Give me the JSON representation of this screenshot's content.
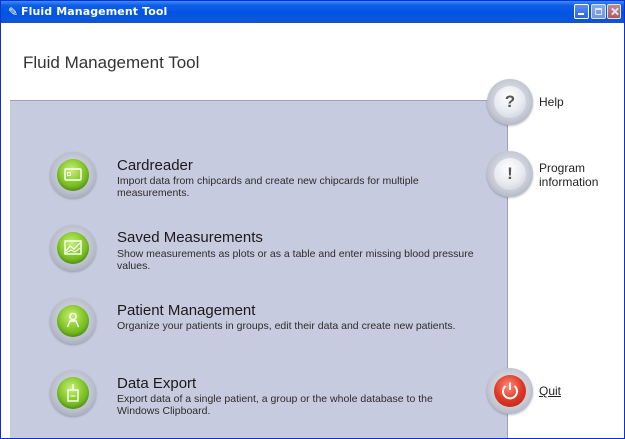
{
  "window": {
    "title": "Fluid Management Tool",
    "title_icon": "pencil-app-icon",
    "colors": {
      "titlebar": "#0054e3",
      "panel": "#c6cbe0",
      "accent_green": "#86c82b",
      "quit_red": "#e03a26"
    }
  },
  "header": {
    "title": "Fluid Management Tool"
  },
  "features": [
    {
      "title": "Cardreader",
      "description": "Import data from chipcards and create new chipcards for multiple measurements.",
      "icon": "card-icon"
    },
    {
      "title": "Saved Measurements",
      "description": "Show measurements as plots or as a table and enter missing blood pressure values.",
      "icon": "chart-icon"
    },
    {
      "title": "Patient Management",
      "description": "Organize your patients in groups, edit their data and create new patients.",
      "icon": "patient-icon"
    },
    {
      "title": "Data Export",
      "description": "Export data of a single patient, a group or the whole database to the Windows Clipboard.",
      "icon": "export-icon"
    }
  ],
  "side": {
    "help": {
      "symbol": "?",
      "label": "Help"
    },
    "info": {
      "symbol": "!",
      "label": "Program\ninformation"
    },
    "quit": {
      "label": "Quit",
      "icon": "power-icon"
    }
  }
}
